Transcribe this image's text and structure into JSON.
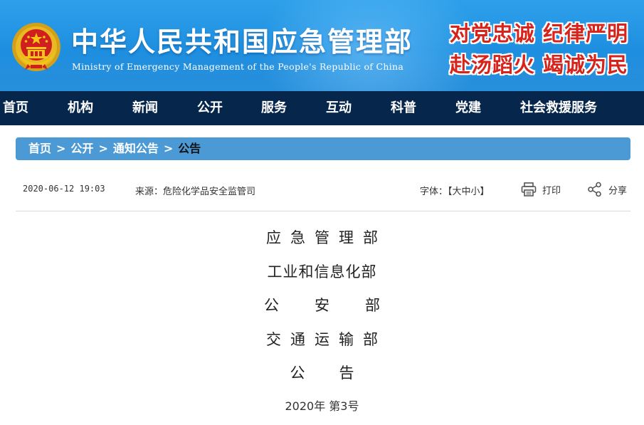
{
  "header": {
    "title": "中华人民共和国应急管理部",
    "subtitle": "Ministry of Emergency Management of the People's Republic of China",
    "slogan_line1": "对党忠诚 纪律严明",
    "slogan_line2": "赴汤蹈火 竭诚为民",
    "emblem_icon": "national-emblem-icon"
  },
  "nav": {
    "items": [
      {
        "label": "首页"
      },
      {
        "label": "机构"
      },
      {
        "label": "新闻"
      },
      {
        "label": "公开"
      },
      {
        "label": "服务"
      },
      {
        "label": "互动"
      },
      {
        "label": "科普"
      },
      {
        "label": "党建"
      },
      {
        "label": "社会救援服务"
      }
    ]
  },
  "breadcrumb": {
    "items": [
      "首页",
      "公开",
      "通知公告"
    ],
    "separator": ">",
    "current": "公告"
  },
  "meta": {
    "date": "2020-06-12 19:03",
    "source": "来源：危险化学品安全监管司",
    "font_size_label": "字体：【大中小】",
    "print_label": "打印",
    "share_label": "分享",
    "print_icon": "printer-icon",
    "share_icon": "share-icon"
  },
  "document": {
    "issuers": [
      "应急管理部",
      "工业和信息化部",
      "公安部",
      "交通运输部"
    ],
    "doc_type": "公告",
    "number": "2020年  第3号"
  },
  "colors": {
    "header_blue": "#1e8fe0",
    "nav_bg": "#07264b",
    "breadcrumb_bg": "#4b9ad6",
    "slogan_red": "#d6231c"
  }
}
